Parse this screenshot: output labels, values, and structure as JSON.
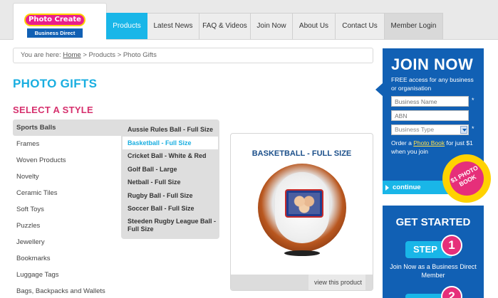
{
  "logo": {
    "top": "Photo Create",
    "bottom": "Business Direct"
  },
  "nav": {
    "products": "Products",
    "news": "Latest News",
    "faq": "FAQ & Videos",
    "join": "Join Now",
    "about": "About Us",
    "contact": "Contact Us",
    "member": "Member Login"
  },
  "breadcrumb": {
    "prefix": "You are here:",
    "home": "Home",
    "rest": "> Products > Photo Gifts"
  },
  "page_title": "PHOTO GIFTS",
  "select_title": "SELECT A STYLE",
  "categories": [
    "Sports Balls",
    "Frames",
    "Woven Products",
    "Novelty",
    "Ceramic Tiles",
    "Soft Toys",
    "Puzzles",
    "Jewellery",
    "Bookmarks",
    "Luggage Tags",
    "Bags, Backpacks and Wallets"
  ],
  "sub_items": [
    "Aussie Rules Ball - Full Size",
    "Basketball - Full Size",
    "Cricket Ball - White & Red",
    "Golf Ball - Large",
    "Netball - Full Size",
    "Rugby Ball - Full Size",
    "Soccer Ball - Full Size",
    "Steeden Rugby League Ball - Full Size"
  ],
  "product": {
    "title": "BASKETBALL - FULL SIZE",
    "view_label": "view this product"
  },
  "join": {
    "title": "JOIN NOW",
    "subtitle": "FREE access for any business or organisation",
    "business_name_placeholder": "Business Name",
    "abn_placeholder": "ABN",
    "business_type": "Business Type",
    "required": "*",
    "order_prefix": "Order a",
    "order_link": "Photo Book",
    "order_suffix": "for just $1 when you join",
    "continue_label": "continue",
    "badge": "$1 PHOTO BOOK"
  },
  "started": {
    "title": "GET STARTED",
    "step_label": "STEP",
    "step1_num": "1",
    "step1_text": "Join Now as a Business Direct Member",
    "step2_num": "2"
  },
  "colors": {
    "accent_blue": "#19b6e8",
    "brand_navy": "#1160b4",
    "pink": "#d6306d"
  }
}
